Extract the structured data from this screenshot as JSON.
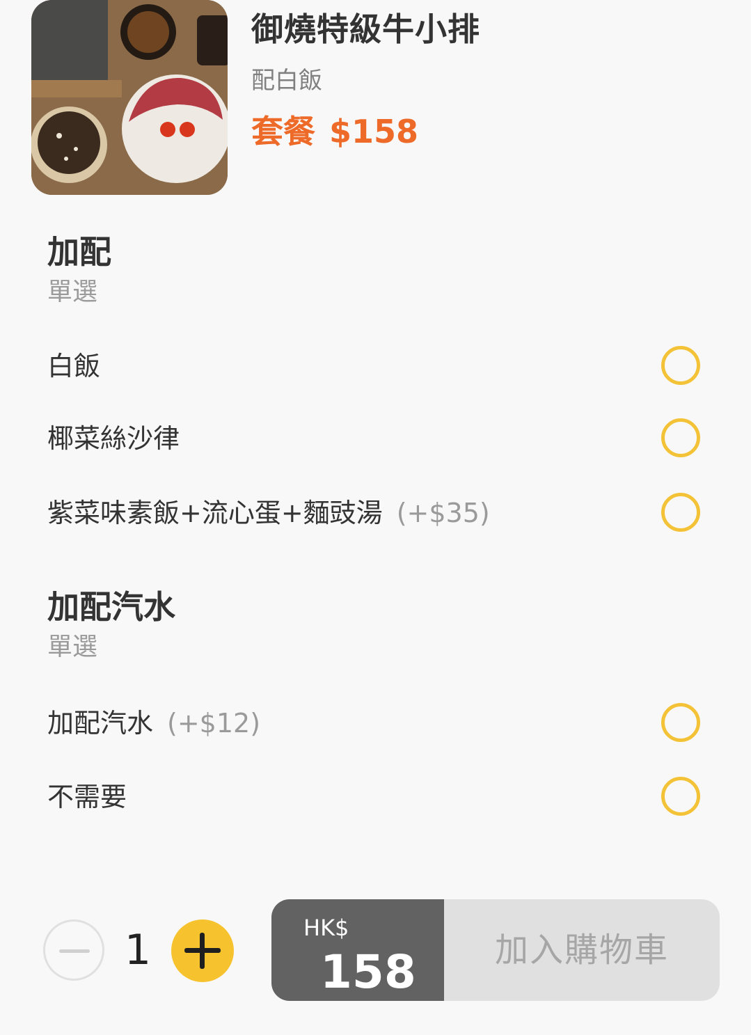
{
  "item": {
    "title": "御燒特級牛小排",
    "subtitle": "配白飯",
    "price_label": "套餐",
    "price": "$158"
  },
  "groups": [
    {
      "title": "加配",
      "note": "單選",
      "options": [
        {
          "label": "白飯",
          "extra": ""
        },
        {
          "label": "椰菜絲沙律",
          "extra": ""
        },
        {
          "label": "紫菜味素飯+流心蛋+麵豉湯",
          "extra": "(+$35)"
        }
      ]
    },
    {
      "title": "加配汽水",
      "note": "單選",
      "options": [
        {
          "label": "加配汽水",
          "extra": "(+$12)"
        },
        {
          "label": "不需要",
          "extra": ""
        }
      ]
    }
  ],
  "quantity": {
    "value": "1",
    "minus_icon": "minus-icon",
    "plus_icon": "plus-icon"
  },
  "cart": {
    "currency": "HK$",
    "amount": "158",
    "add_label": "加入購物車"
  },
  "colors": {
    "accent_price": "#ee6a29",
    "radio_border": "#f4c236",
    "plus_button": "#f6c22e",
    "total_panel": "#626262"
  }
}
